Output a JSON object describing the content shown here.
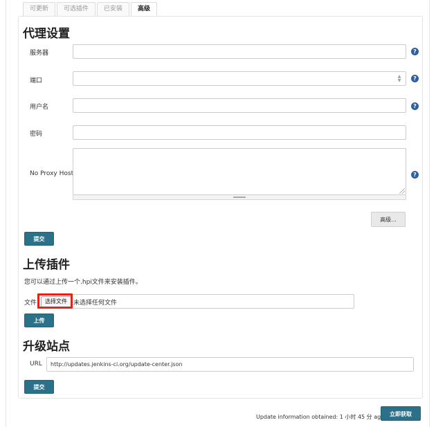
{
  "tabs": [
    {
      "label": "可更新"
    },
    {
      "label": "可选插件"
    },
    {
      "label": "已安装"
    },
    {
      "label": "高级"
    }
  ],
  "proxy": {
    "title": "代理设置",
    "server_label": "服务器",
    "port_label": "端口",
    "username_label": "用户名",
    "password_label": "密码",
    "no_proxy_label": "No Proxy Host",
    "server_value": "",
    "port_value": "",
    "username_value": "",
    "password_value": "",
    "no_proxy_value": "",
    "advanced_button": "高级...",
    "submit_button": "提交"
  },
  "upload": {
    "title": "上传插件",
    "description": "您可以通过上传一个.hpi文件来安装插件。",
    "file_label": "文件:",
    "choose_button": "选择文件",
    "no_file_text": "未选择任何文件",
    "upload_button": "上传"
  },
  "site": {
    "title": "升级站点",
    "url_label": "URL",
    "url_value": "http://updates.jenkins-ci.org/update-center.json",
    "submit_button": "提交"
  },
  "footer": {
    "status_text": "Update information obtained: 1 小时 45 分 ago",
    "check_now_button": "立即获取"
  },
  "colors": {
    "primary": "#2b7189",
    "help_icon": "#2f5f9f",
    "highlight": "#e0241b"
  }
}
